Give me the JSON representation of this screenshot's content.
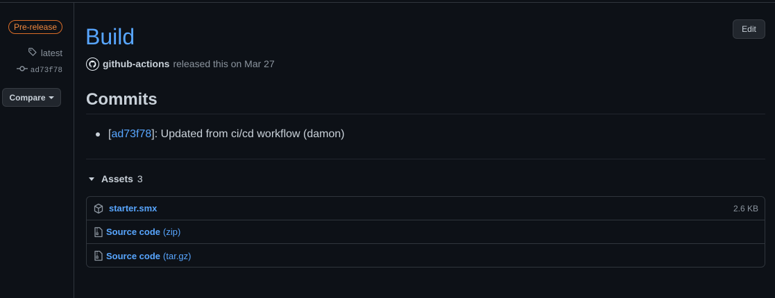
{
  "sidebar": {
    "prerelease_label": "Pre-release",
    "tag": "latest",
    "commit": "ad73f78",
    "compare_label": "Compare"
  },
  "release": {
    "title": "Build",
    "edit_label": "Edit",
    "actor": "github-actions",
    "released_text": "released this on Mar 27"
  },
  "commits": {
    "heading": "Commits",
    "items": [
      {
        "open_bracket": "[",
        "hash": "ad73f78",
        "message": "]: Updated from ci/cd workflow (damon)"
      }
    ]
  },
  "assets": {
    "label": "Assets",
    "count": "3",
    "items": [
      {
        "name": "starter.smx",
        "suffix": "",
        "size": "2.6 KB",
        "icon": "package-icon"
      },
      {
        "name": "Source code",
        "suffix": "(zip)",
        "size": "",
        "icon": "file-zip-icon"
      },
      {
        "name": "Source code",
        "suffix": "(tar.gz)",
        "size": "",
        "icon": "file-zip-icon"
      }
    ]
  },
  "colors": {
    "background": "#0d1117",
    "link": "#58a6ff",
    "prerelease": "#f0883e",
    "muted": "#8b949e"
  }
}
